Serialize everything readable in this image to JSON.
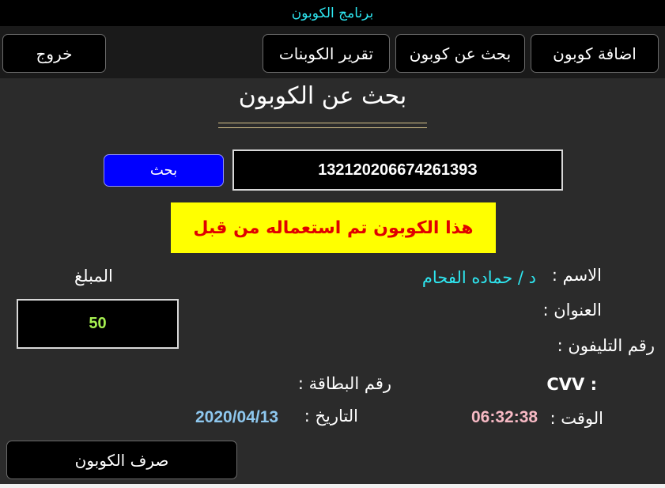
{
  "window": {
    "title": "برنامج الكوبون"
  },
  "nav": {
    "add_coupon": "اضافة كوبون",
    "search_coupon": "بحث عن كوبون",
    "coupons_report": "تقرير الكوبنات",
    "exit": "خروج"
  },
  "page": {
    "title": "بحث عن الكوبون"
  },
  "search": {
    "button_label": "بحث",
    "code_value": "13212020667426139З"
  },
  "alert": {
    "message": "هذا الكوبون تم استعماله من قبل"
  },
  "details": {
    "name_label": "الاسم :",
    "name_value": "د / حماده الفحام",
    "address_label": "العنوان :",
    "phone_label": "رقم التليفون :",
    "cvv_label": "CVV :",
    "card_number_label": "رقم البطاقة :",
    "time_label": "الوقت :",
    "time_value": "06:32:38",
    "date_label": "التاريخ :",
    "date_value": "2020/04/13"
  },
  "amount": {
    "label": "المبلغ",
    "value": "50"
  },
  "actions": {
    "redeem_label": "صرف الكوبون"
  },
  "colors": {
    "title_text": "#2ee6f0",
    "name_value": "#2ee6f0",
    "amount_value": "#a6f050",
    "time_value": "#f7b9c4",
    "date_value": "#8ec7ee",
    "alert_bg": "#ffff00",
    "alert_text": "#e00000",
    "search_button": "#0000ff"
  }
}
